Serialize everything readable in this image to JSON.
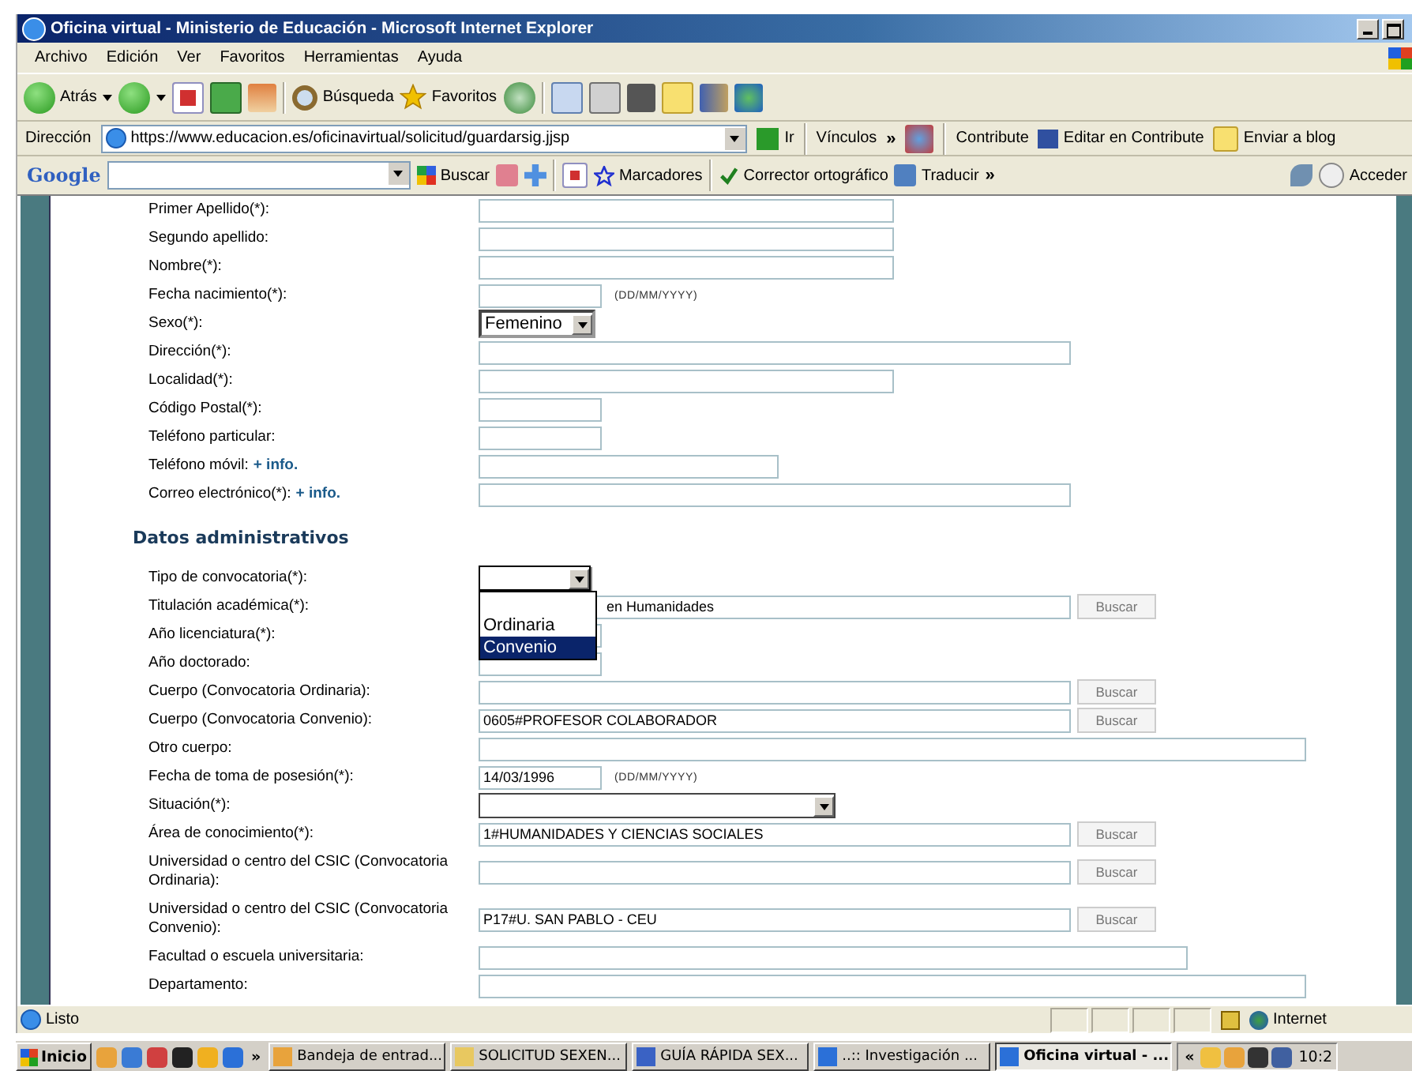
{
  "window": {
    "title": "Oficina virtual - Ministerio de Educación - Microsoft Internet Explorer"
  },
  "menu": [
    "Archivo",
    "Edición",
    "Ver",
    "Favoritos",
    "Herramientas",
    "Ayuda"
  ],
  "toolbar": {
    "back": "Atrás",
    "search": "Búsqueda",
    "favorites": "Favoritos"
  },
  "address_bar": {
    "label": "Dirección",
    "url": "https://www.educacion.es/oficinavirtual/solicitud/guardarsig.jjsp",
    "go": "Ir",
    "links": "Vínculos",
    "chevron": "»",
    "contribute": "Contribute",
    "edit_contribute": "Editar en Contribute",
    "blog": "Enviar a blog"
  },
  "google_bar": {
    "logo": "Google",
    "search": "Buscar",
    "bookmarks": "Marcadores",
    "spell": "Corrector ortográfico",
    "translate": "Traducir",
    "chevron": "»",
    "sign_in": "Acceder"
  },
  "form": {
    "personal": [
      {
        "label": "Primer Apellido(*):",
        "kind": "input"
      },
      {
        "label": "Segundo apellido:",
        "kind": "input"
      },
      {
        "label": "Nombre(*):",
        "kind": "input"
      },
      {
        "label": "Fecha nacimiento(*):",
        "kind": "input",
        "hint": "(DD/MM/YYYY)"
      },
      {
        "label": "Sexo(*):",
        "kind": "select",
        "value": "Femenino"
      },
      {
        "label": "Dirección(*):",
        "kind": "input"
      },
      {
        "label": "Localidad(*):",
        "kind": "input"
      },
      {
        "label": "Código Postal(*):",
        "kind": "input"
      },
      {
        "label": "Teléfono particular:",
        "kind": "input"
      },
      {
        "label": "Teléfono móvil:",
        "link": "+ info.",
        "kind": "input"
      },
      {
        "label": "Correo electrónico(*):",
        "link": "+ info.",
        "kind": "input"
      }
    ],
    "admin_heading": "Datos administrativos",
    "admin": [
      {
        "label": "Tipo de convocatoria(*):",
        "kind": "select",
        "expanded": true,
        "options": [
          {
            "label": "Ordinaria",
            "selected": false
          },
          {
            "label": "Convenio",
            "selected": true
          }
        ]
      },
      {
        "label": "Titulación académica(*):",
        "kind": "input",
        "value": "en Humanidades",
        "button": "Buscar"
      },
      {
        "label": "Año licenciatura(*):",
        "kind": "input"
      },
      {
        "label": "Año doctorado:",
        "kind": "input"
      },
      {
        "label": "Cuerpo (Convocatoria Ordinaria):",
        "kind": "input",
        "button": "Buscar"
      },
      {
        "label": "Cuerpo (Convocatoria Convenio):",
        "kind": "input",
        "value": "0605#PROFESOR COLABORADOR",
        "button": "Buscar"
      },
      {
        "label": "Otro cuerpo:",
        "kind": "input"
      },
      {
        "label": "Fecha de toma de posesión(*):",
        "kind": "input",
        "value": "14/03/1996",
        "hint": "(DD/MM/YYYY)"
      },
      {
        "label": "Situación(*):",
        "kind": "select"
      },
      {
        "label": "Área de conocimiento(*):",
        "kind": "input",
        "value": " 1#HUMANIDADES Y CIENCIAS SOCIALES",
        "button": "Buscar"
      },
      {
        "label": "Universidad o centro del CSIC (Convocatoria Ordinaria):",
        "kind": "input",
        "button": "Buscar"
      },
      {
        "label": "Universidad o centro del CSIC (Convocatoria Convenio):",
        "kind": "input",
        "value": "P17#U. SAN PABLO - CEU",
        "button": "Buscar"
      },
      {
        "label": "Facultad o escuela universitaria:",
        "kind": "input"
      },
      {
        "label": "Departamento:",
        "kind": "input"
      }
    ]
  },
  "status_bar": {
    "text": "Listo",
    "zone": "Internet"
  },
  "taskbar": {
    "start": "Inicio",
    "chevron": "»",
    "tasks": [
      {
        "label": "Bandeja de entrad...",
        "selected": false
      },
      {
        "label": "SOLICITUD SEXEN...",
        "selected": false
      },
      {
        "label": "GUÍA RÁPIDA SEX...",
        "selected": false
      },
      {
        "label": "..:: Investigación ...",
        "selected": false
      },
      {
        "label": "Oficina virtual - ...",
        "selected": true
      }
    ],
    "tray_chevron": "«",
    "clock": "10:2"
  }
}
